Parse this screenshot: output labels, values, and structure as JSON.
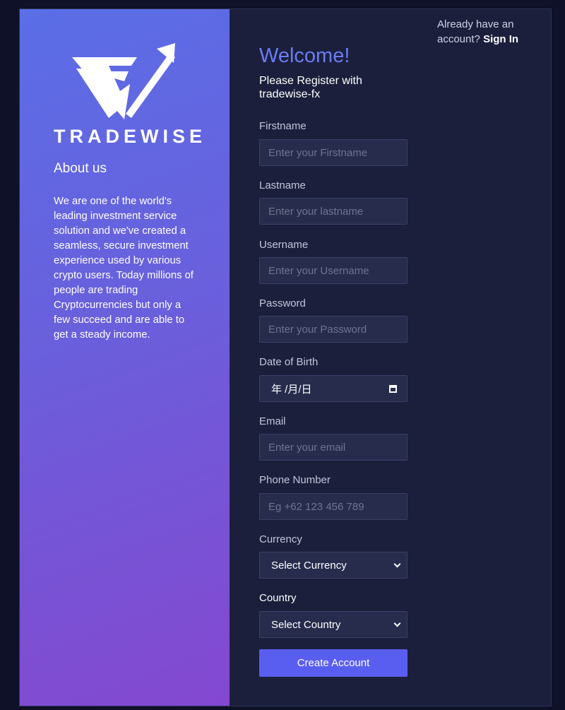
{
  "brand": {
    "name": "TRADEWISE"
  },
  "about": {
    "title": "About us",
    "text": "We are one of the world's leading investment service solution and we've created a seamless, secure investment experience used by various crypto users. Today millions of people are trading Cryptocurrencies but only a few succeed and are able to get a steady income."
  },
  "signin": {
    "prefix": "Already have an account?",
    "link": "Sign In"
  },
  "form": {
    "welcome": "Welcome!",
    "subtitle": "Please Register with tradewise-fx",
    "firstname": {
      "label": "Firstname",
      "placeholder": "Enter your Firstname",
      "value": ""
    },
    "lastname": {
      "label": "Lastname",
      "placeholder": "Enter your lastname",
      "value": ""
    },
    "username": {
      "label": "Username",
      "placeholder": "Enter your Username",
      "value": ""
    },
    "password": {
      "label": "Password",
      "placeholder": "Enter your Password",
      "value": ""
    },
    "dob": {
      "label": "Date of Birth",
      "value": "年 /月/日"
    },
    "email": {
      "label": "Email",
      "placeholder": "Enter your email",
      "value": ""
    },
    "phone": {
      "label": "Phone Number",
      "placeholder": "Eg +62 123 456 789",
      "value": ""
    },
    "currency": {
      "label": "Currency",
      "selected": "Select Currency"
    },
    "country": {
      "label": "Country",
      "selected": "Select Country"
    },
    "submit": "Create Account"
  },
  "icons": {
    "logo": "tradewise-logo-icon",
    "calendar": "calendar-icon",
    "chevron": "chevron-down-icon"
  },
  "colors": {
    "background": "#1b1f3c",
    "panel_gradient_start": "#5a6ee6",
    "panel_gradient_end": "#8448cf",
    "accent": "#6b7cf5",
    "button": "#5a5ef0",
    "input_bg": "#272c4d"
  }
}
